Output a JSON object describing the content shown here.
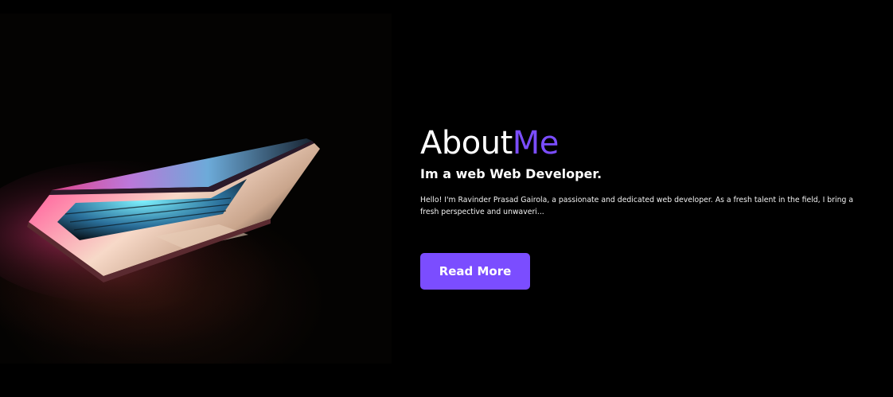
{
  "about": {
    "title_main": "About",
    "title_accent": "Me",
    "subtitle": "Im a web Web Developer.",
    "description": "Hello! I'm Ravinder Prasad Gairola, a passionate and dedicated web developer. As a fresh talent in the field, I bring a fresh perspective and unwaveri...",
    "read_more_label": "Read More"
  },
  "colors": {
    "background": "#000000",
    "accent": "#7b4dff",
    "text": "#ffffff"
  },
  "image": {
    "subject": "laptop-photo"
  }
}
